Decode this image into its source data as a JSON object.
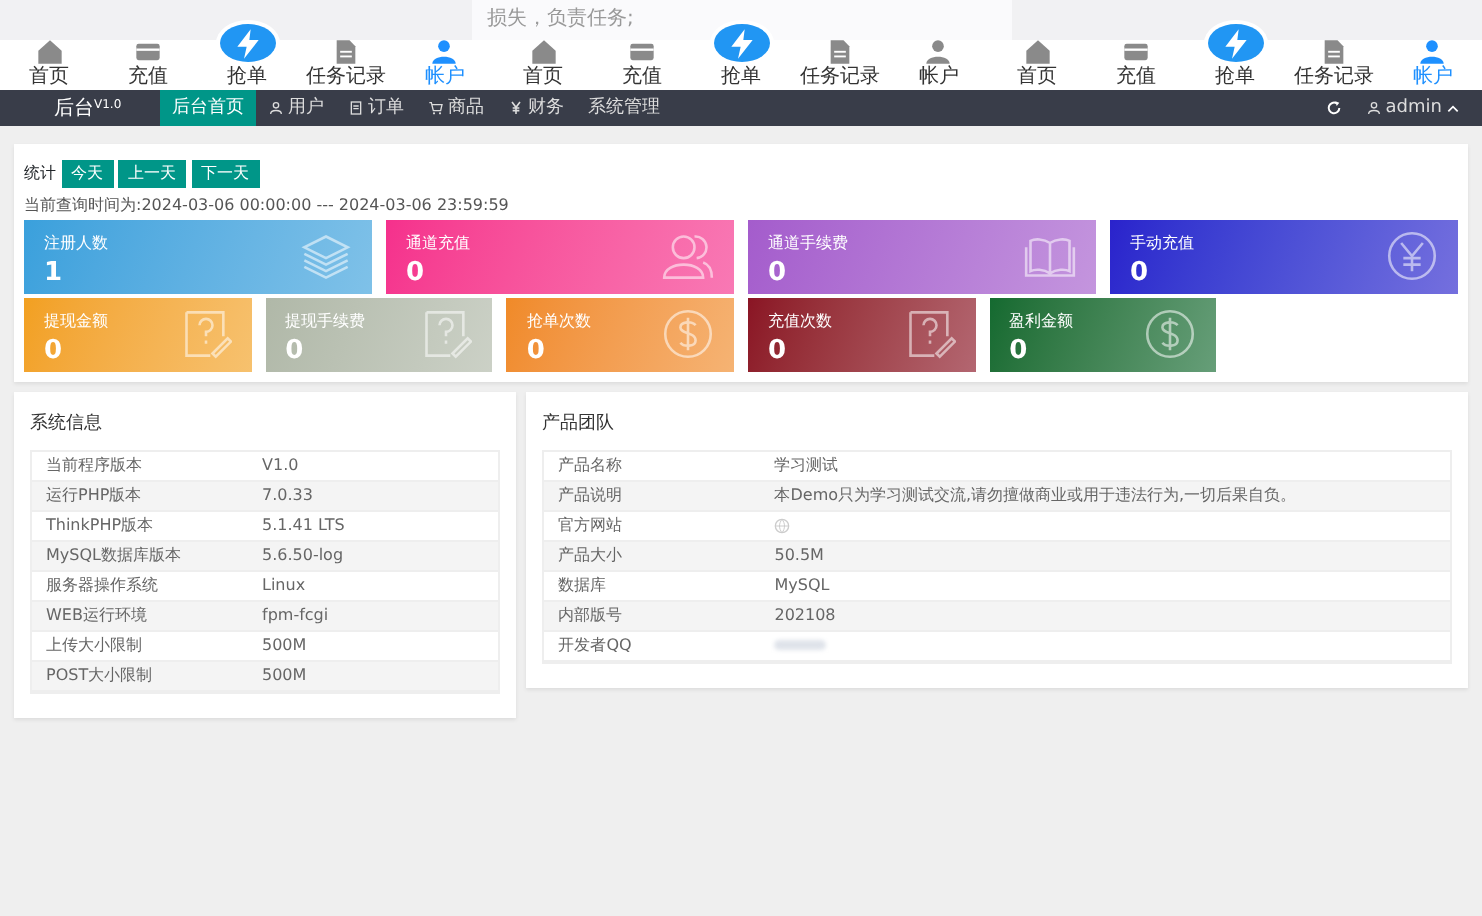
{
  "notice": "损失，负责任务;",
  "bottom_nav_groups": [
    {
      "items": [
        {
          "label": "首页",
          "selected": false
        },
        {
          "label": "充值",
          "selected": false
        },
        {
          "label": "抢单",
          "selected": false
        },
        {
          "label": "任务记录",
          "selected": false
        },
        {
          "label": "帐户",
          "selected": true
        }
      ]
    },
    {
      "items": [
        {
          "label": "首页",
          "selected": false
        },
        {
          "label": "充值",
          "selected": false
        },
        {
          "label": "抢单",
          "selected": false
        },
        {
          "label": "任务记录",
          "selected": false
        },
        {
          "label": "帐户",
          "selected": false
        }
      ]
    },
    {
      "items": [
        {
          "label": "首页",
          "selected": false
        },
        {
          "label": "充值",
          "selected": false
        },
        {
          "label": "抢单",
          "selected": false
        },
        {
          "label": "任务记录",
          "selected": false
        },
        {
          "label": "帐户",
          "selected": true
        }
      ]
    }
  ],
  "navbar": {
    "brand": "后台",
    "version": "V1.0",
    "tabs": [
      {
        "label": "后台首页",
        "selected": true
      },
      {
        "label": "用户",
        "selected": false
      },
      {
        "label": "订单",
        "selected": false
      },
      {
        "label": "商品",
        "selected": false
      },
      {
        "label": "财务",
        "selected": false
      },
      {
        "label": "系统管理",
        "selected": false
      }
    ],
    "user": "admin"
  },
  "stats": {
    "label": "统计",
    "buttons": [
      "今天",
      "上一天",
      "下一天"
    ],
    "query_time": "当前查询时间为:2024-03-06 00:00:00 --- 2024-03-06 23:59:59",
    "tiles": [
      {
        "label": "注册人数",
        "value": "1",
        "color": "#3aa0dc"
      },
      {
        "label": "通道充值",
        "value": "0",
        "color": "#f5308c"
      },
      {
        "label": "通道手续费",
        "value": "0",
        "color": "#a45ccc"
      },
      {
        "label": "手动充值",
        "value": "0",
        "color": "#2a22cc"
      },
      {
        "label": "提现金额",
        "value": "0",
        "color": "#f2a020"
      },
      {
        "label": "提现手续费",
        "value": "0",
        "color": "#b0b8a8"
      },
      {
        "label": "抢单次数",
        "value": "0",
        "color": "#f08a28"
      },
      {
        "label": "充值次数",
        "value": "0",
        "color": "#8a1424"
      },
      {
        "label": "盈利金额",
        "value": "0",
        "color": "#146a30"
      }
    ]
  },
  "system_info": {
    "title": "系统信息",
    "rows": [
      [
        "当前程序版本",
        "V1.0"
      ],
      [
        "运行PHP版本",
        "7.0.33"
      ],
      [
        "ThinkPHP版本",
        "5.1.41 LTS"
      ],
      [
        "MySQL数据库版本",
        "5.6.50-log"
      ],
      [
        "服务器操作系统",
        "Linux"
      ],
      [
        "WEB运行环境",
        "fpm-fcgi"
      ],
      [
        "上传大小限制",
        "500M"
      ],
      [
        "POST大小限制",
        "500M"
      ]
    ]
  },
  "product_team": {
    "title": "产品团队",
    "rows": [
      {
        "kind": "text",
        "label": "产品名称",
        "value": "学习测试"
      },
      {
        "kind": "text",
        "label": "产品说明",
        "value": "本Demo只为学习测试交流,请勿擅做商业或用于违法行为,一切后果自负。"
      },
      {
        "kind": "icon",
        "label": "官方网站"
      },
      {
        "kind": "text",
        "label": "产品大小",
        "value": "50.5M"
      },
      {
        "kind": "text",
        "label": "数据库",
        "value": "MySQL"
      },
      {
        "kind": "text",
        "label": "内部版号",
        "value": "202108"
      },
      {
        "kind": "redacted",
        "label": "开发者QQ"
      }
    ]
  }
}
